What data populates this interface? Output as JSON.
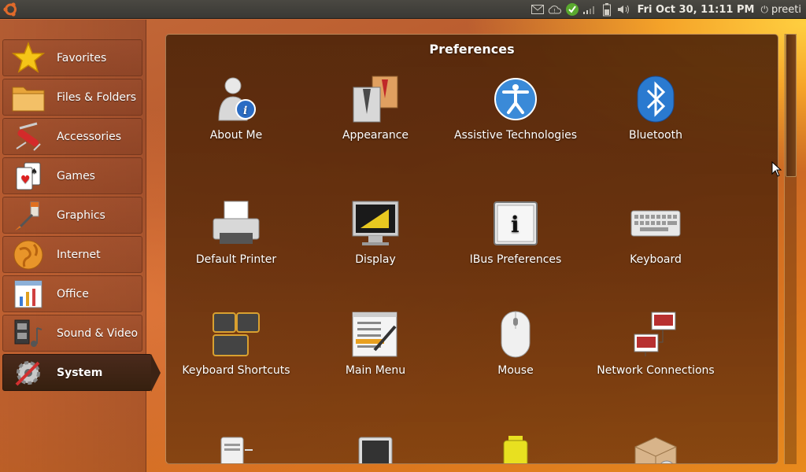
{
  "top_panel": {
    "clock": "Fri Oct 30, 11:11 PM",
    "user": "preeti",
    "icons": [
      "mail-icon",
      "weather-icon",
      "update-check-icon",
      "network-signal-icon",
      "battery-icon",
      "volume-icon"
    ]
  },
  "sidebar": {
    "categories": [
      {
        "label": "Favorites",
        "icon": "star-icon"
      },
      {
        "label": "Files & Folders",
        "icon": "folder-icon"
      },
      {
        "label": "Accessories",
        "icon": "swiss-knife-icon"
      },
      {
        "label": "Games",
        "icon": "playing-cards-icon"
      },
      {
        "label": "Graphics",
        "icon": "paint-brush-icon"
      },
      {
        "label": "Internet",
        "icon": "globe-icon"
      },
      {
        "label": "Office",
        "icon": "spreadsheet-icon"
      },
      {
        "label": "Sound & Video",
        "icon": "film-music-icon"
      },
      {
        "label": "System",
        "icon": "gear-wrench-icon",
        "selected": true
      }
    ]
  },
  "main": {
    "title": "Preferences",
    "items": [
      {
        "label": "About Me",
        "icon": "user-info-icon"
      },
      {
        "label": "Appearance",
        "icon": "appearance-shirt-icon"
      },
      {
        "label": "Assistive Technologies",
        "icon": "accessibility-icon"
      },
      {
        "label": "Bluetooth",
        "icon": "bluetooth-icon"
      },
      {
        "label": "Default Printer",
        "icon": "printer-icon"
      },
      {
        "label": "Display",
        "icon": "display-icon"
      },
      {
        "label": "IBus Preferences",
        "icon": "ibus-info-icon"
      },
      {
        "label": "Keyboard",
        "icon": "keyboard-icon"
      },
      {
        "label": "Keyboard Shortcuts",
        "icon": "keyboard-shortcuts-icon"
      },
      {
        "label": "Main Menu",
        "icon": "main-menu-icon"
      },
      {
        "label": "Mouse",
        "icon": "mouse-icon"
      },
      {
        "label": "Network Connections",
        "icon": "network-connections-icon"
      },
      {
        "label": "",
        "icon": "server-icon"
      },
      {
        "label": "",
        "icon": "tablet-icon"
      },
      {
        "label": "",
        "icon": "power-battery-icon"
      },
      {
        "label": "",
        "icon": "package-icon"
      }
    ]
  },
  "colors": {
    "panel": "#3a3935",
    "selected_category": "#3d2314",
    "accent_orange": "#e88a1d"
  }
}
